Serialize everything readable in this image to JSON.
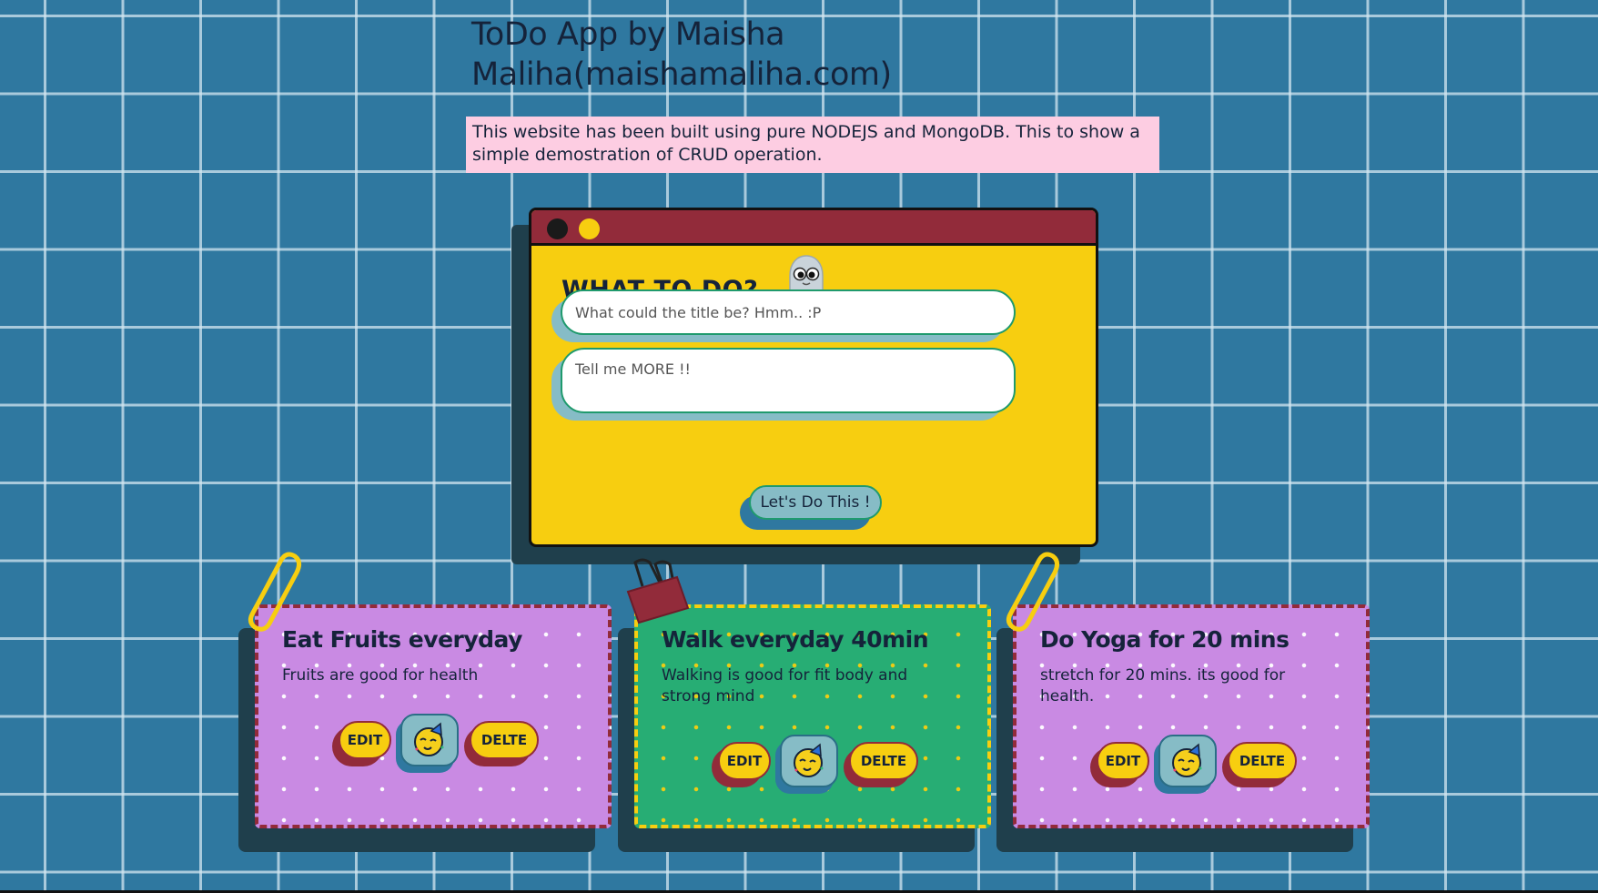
{
  "header": {
    "title": "ToDo App by Maisha Maliha(maishamaliha.com)",
    "description": "This website has been built using pure NODEJS and MongoDB. This to show a simple demostration of CRUD operation."
  },
  "form": {
    "heading": "WHAT TO DO?",
    "title_placeholder": "What could the title be? Hmm.. :P",
    "body_placeholder": "Tell me MORE !!",
    "submit_label": "Let's Do This !"
  },
  "todos": [
    {
      "title": "Eat Fruits everyday",
      "body": "Fruits are good for health",
      "edit_label": "EDIT",
      "delete_label": "DELTE",
      "color": "purple",
      "clip": "paperclip-icon"
    },
    {
      "title": "Walk everyday 40min",
      "body": "Walking is good for fit body and strong mind",
      "edit_label": "EDIT",
      "delete_label": "DELTE",
      "color": "green",
      "clip": "binder-clip-icon"
    },
    {
      "title": "Do Yoga for 20 mins",
      "body": "stretch for 20 mins. its good for health.",
      "edit_label": "EDIT",
      "delete_label": "DELTE",
      "color": "purple",
      "clip": "paperclip-icon"
    }
  ],
  "colors": {
    "background": "#2f78a0",
    "window_bar": "#922b3a",
    "window_body": "#f7ce10",
    "card_purple": "#c98ae3",
    "card_green": "#27ad74",
    "description_bg": "#fdcde2"
  }
}
